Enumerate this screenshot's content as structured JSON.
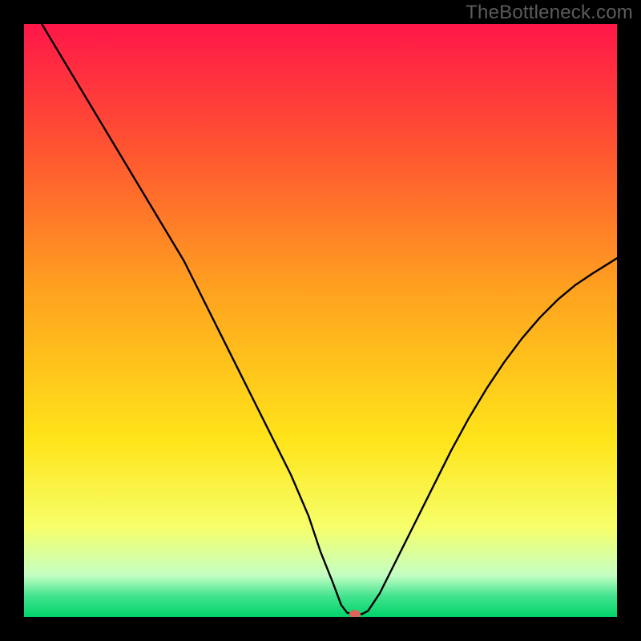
{
  "watermark": "TheBottleneck.com",
  "chart_data": {
    "type": "line",
    "title": "",
    "xlabel": "",
    "ylabel": "",
    "xlim": [
      0,
      100
    ],
    "ylim": [
      0,
      100
    ],
    "background_gradient": {
      "stops": [
        {
          "offset": 0.0,
          "color": "#ff1749"
        },
        {
          "offset": 0.2,
          "color": "#ff5132"
        },
        {
          "offset": 0.45,
          "color": "#ffa21f"
        },
        {
          "offset": 0.7,
          "color": "#ffe419"
        },
        {
          "offset": 0.85,
          "color": "#f6ff6b"
        },
        {
          "offset": 0.93,
          "color": "#c3ffc3"
        },
        {
          "offset": 0.965,
          "color": "#42e38e"
        },
        {
          "offset": 1.0,
          "color": "#00d46a"
        }
      ]
    },
    "series": [
      {
        "name": "bottleneck-curve",
        "color": "#000000",
        "stroke_width": 2.4,
        "x": [
          3,
          6,
          9,
          12,
          15,
          18,
          21,
          24,
          27,
          30,
          33,
          36,
          39,
          42,
          45,
          48,
          50,
          52,
          53.5,
          54.5,
          55.5,
          57,
          58,
          60,
          63,
          66,
          69,
          72,
          75,
          78,
          81,
          84,
          87,
          90,
          93,
          96,
          100
        ],
        "y": [
          100,
          95,
          90,
          85,
          80,
          75,
          70,
          65,
          60,
          54,
          48,
          42,
          36,
          30,
          24,
          17,
          11,
          6,
          2,
          0.7,
          0.5,
          0.5,
          1,
          4,
          10,
          16,
          22,
          28,
          33.5,
          38.5,
          43,
          47,
          50.5,
          53.5,
          56,
          58,
          60.5
        ]
      }
    ],
    "marker": {
      "name": "highlight-point",
      "x": 55.8,
      "y": 0.5,
      "rx": 7,
      "ry": 5,
      "fill": "#dc645b"
    }
  }
}
